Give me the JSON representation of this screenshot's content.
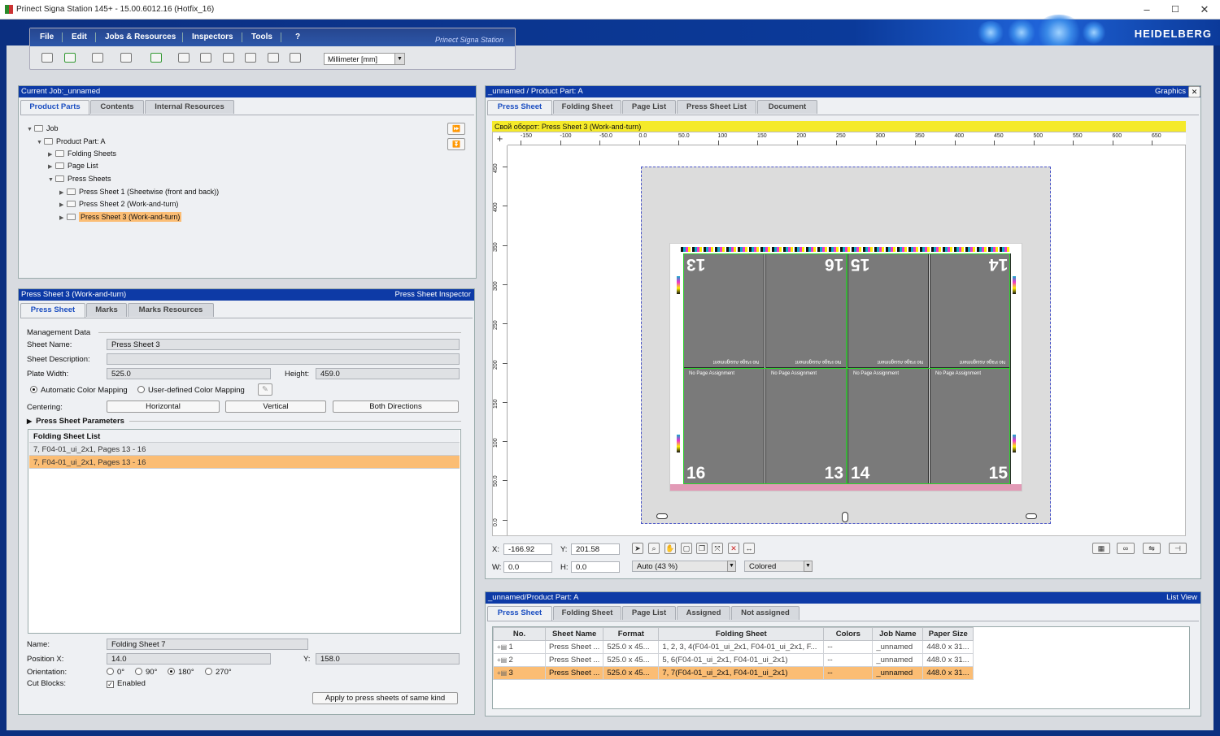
{
  "window": {
    "title": "Prinect Signa Station 145+  -  15.00.6012.16 (Hotfix_16)",
    "minimize": "–",
    "maximize": "☐",
    "close": "✕"
  },
  "brand": {
    "logo": "HEIDELBERG",
    "menu_brand": "Prinect Signa Station"
  },
  "menu": {
    "items": [
      "File",
      "Edit",
      "Jobs & Resources",
      "Inspectors",
      "Tools",
      "?"
    ]
  },
  "toolbar": {
    "unit": "Millimeter  [mm]",
    "dropdown_glyph": "▼"
  },
  "job_panel": {
    "header": "Current Job:_unnamed",
    "tabs": [
      "Product Parts",
      "Contents",
      "Internal Resources"
    ],
    "tree": [
      {
        "label": "Job"
      },
      {
        "label": "Product Part: A"
      },
      {
        "label": "Folding Sheets"
      },
      {
        "label": "Page List"
      },
      {
        "label": "Press Sheets"
      },
      {
        "label": "Press Sheet 1 (Sheetwise (front and back))"
      },
      {
        "label": "Press Sheet 2 (Work-and-turn)"
      },
      {
        "label": "Press Sheet 3 (Work-and-turn)"
      }
    ],
    "side_buttons": [
      "⏩",
      "⏬"
    ]
  },
  "inspector": {
    "header_left": "Press Sheet 3 (Work-and-turn)",
    "header_right": "Press Sheet Inspector",
    "tabs": [
      "Press Sheet",
      "Marks",
      "Marks Resources"
    ],
    "section_management": "Management Data",
    "sheet_name_label": "Sheet Name:",
    "sheet_name_value": "Press Sheet 3",
    "sheet_desc_label": "Sheet Description:",
    "sheet_desc_value": "",
    "plate_width_label": "Plate Width:",
    "plate_width_value": "525.0",
    "height_label": "Height:",
    "height_value": "459.0",
    "color_auto": "Automatic Color Mapping",
    "color_user": "User-defined Color Mapping",
    "centering_label": "Centering:",
    "centering": [
      "Horizontal",
      "Vertical",
      "Both Directions"
    ],
    "press_sheet_params": "Press Sheet Parameters",
    "folding_list_header": "Folding Sheet List",
    "folding_list": [
      "7, F04-01_ui_2x1, Pages 13 - 16",
      "7, F04-01_ui_2x1, Pages 13 - 16"
    ],
    "name_label": "Name:",
    "name_value": "Folding Sheet 7",
    "posx_label": "Position X:",
    "posx_value": "14.0",
    "posy_label": "Y:",
    "posy_value": "158.0",
    "orientation_label": "Orientation:",
    "orientations": [
      "0°",
      "90°",
      "180°",
      "270°"
    ],
    "cutblocks_label": "Cut Blocks:",
    "cutblocks_value": "Enabled",
    "apply_button": "Apply to press sheets of same kind"
  },
  "graphics": {
    "header_left": "_unnamed / Product Part: A",
    "header_right": "Graphics",
    "close": "✕",
    "tabs": [
      "Press Sheet",
      "Folding Sheet",
      "Page List",
      "Press Sheet List",
      "Document"
    ],
    "sheet_caption": "Свой оборот:  Press Sheet 3 (Work-and-turn)",
    "ruler_h": [
      "-150",
      "-100",
      "-50.0",
      "0.0",
      "50.0",
      "100",
      "150",
      "200",
      "250",
      "300",
      "350",
      "400",
      "450",
      "500",
      "550",
      "600",
      "650"
    ],
    "ruler_v": [
      "450",
      "400",
      "350",
      "300",
      "250",
      "200",
      "150",
      "100",
      "50.0",
      "0.0"
    ],
    "pages_top": [
      "13",
      "16",
      "15",
      "14"
    ],
    "pages_bottom": [
      "16",
      "13",
      "14",
      "15"
    ],
    "no_page": "No Page Assignment",
    "x_label": "X:",
    "x_value": "-166.92",
    "y_label": "Y:",
    "y_value": "201.58",
    "w_label": "W:",
    "w_value": "0.0",
    "h_label": "H:",
    "h_value": "0.0",
    "zoom": "Auto (43 %)",
    "color_mode": "Colored"
  },
  "listview": {
    "header_left": "_unnamed/Product Part: A",
    "header_right": "List View",
    "tabs": [
      "Press Sheet",
      "Folding Sheet",
      "Page List",
      "Assigned",
      "Not assigned"
    ],
    "columns": [
      "No.",
      "Sheet Name",
      "Format",
      "Folding Sheet",
      "Colors",
      "Job Name",
      "Paper Size"
    ],
    "rows": [
      [
        "1",
        "Press Sheet ...",
        "525.0 x 45...",
        "1, 2, 3, 4(F04-01_ui_2x1, F04-01_ui_2x1, F...",
        "--",
        "_unnamed",
        "448.0 x 31..."
      ],
      [
        "2",
        "Press Sheet ...",
        "525.0 x 45...",
        "5, 6(F04-01_ui_2x1, F04-01_ui_2x1)",
        "--",
        "_unnamed",
        "448.0 x 31..."
      ],
      [
        "3",
        "Press Sheet ...",
        "525.0 x 45...",
        "7, 7(F04-01_ui_2x1, F04-01_ui_2x1)",
        "--",
        "_unnamed",
        "448.0 x 31..."
      ]
    ]
  }
}
